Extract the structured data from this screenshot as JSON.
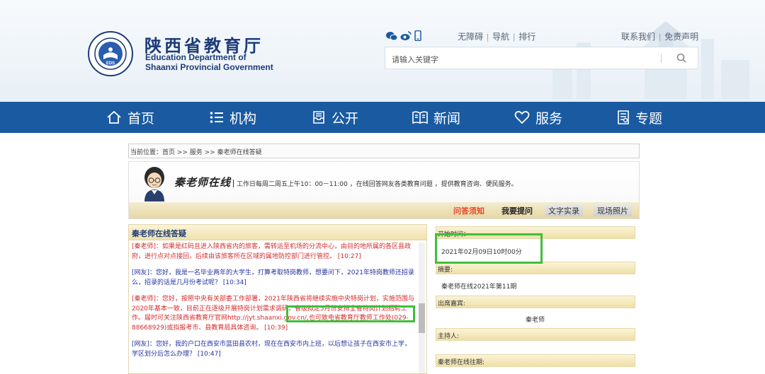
{
  "header": {
    "title_cn": "陕西省教育厅",
    "title_en_line1": "Education Department of",
    "title_en_line2": "Shaanxi Provincial Government",
    "social_icons": [
      "wechat-icon",
      "weibo-icon",
      "mobile-icon"
    ],
    "top_links": [
      "无障碍",
      "导航",
      "排行"
    ],
    "right_links": [
      "联系我们",
      "免责声明"
    ],
    "search": {
      "placeholder": "请输入关键字"
    }
  },
  "nav": {
    "items": [
      {
        "label": "首页",
        "icon": "home-icon"
      },
      {
        "label": "机构",
        "icon": "list-icon"
      },
      {
        "label": "公开",
        "icon": "inbox-icon"
      },
      {
        "label": "新闻",
        "icon": "book-icon"
      },
      {
        "label": "服务",
        "icon": "heart-icon"
      },
      {
        "label": "专题",
        "icon": "document-icon"
      }
    ],
    "color": "#1a5aa1"
  },
  "breadcrumb": "当前位置：首页 >> 服务 >> 秦老师在线答疑",
  "banner": {
    "title": "秦老师在线",
    "description": "工作日每周二周五上午10：00－11:00 ，在线回答网友各类教育问题 ，提供教育咨询、便民服务。",
    "tabs": [
      "问答须知",
      "我要提问",
      "文字实录",
      "现场照片"
    ]
  },
  "chat": {
    "title": "秦老师在线答疑",
    "messages": [
      {
        "role": "host",
        "text": "[秦老师]：如果是红码且进入陕西省内的旅客，需转运至机场的分流中心，由目的地所属的各区县政府，进行点对点接回，后续由该旅客所在区域的属地防控部门进行管控。  [10:27]"
      },
      {
        "role": "user",
        "text": "[网友]：您好，我是一名毕业两年的大学生，打算考取特岗教师，想要问下，2021年特岗教师还招录么，招录的话是几月份考试呢？  [10:34]"
      },
      {
        "role": "host",
        "text": "[秦老师]：您好，按照中央有关部委工作部署，2021年陕西省将继续实施中央特岗计划，实施范围与2020年基本一致，目前正在逐级开展特岗计划需求调研，省级拟定5月份安排全省特岗计划招聘工作。届时可关注陕西省教育厅官网http://jyt.shaanxi.gov.cn/,也可致电省教育厅教师工作处(029-88668929)或拟报考市、县教育局具体咨询。  [10:39]"
      },
      {
        "role": "user",
        "text": "[网友]：您好，我的户口在西安市蓝田县农村，现在在西安市内上班，以后想让孩子在西安市上学，学区划分后怎么办理？  [10:47]"
      }
    ]
  },
  "info": {
    "start_label": "开始时间：",
    "start_value": "2021年02月09日10时00分",
    "summary_label": "摘要:",
    "summary_value": "秦老师在线2021年第11期",
    "guest_label": "出席嘉宾:",
    "guest_value": "秦老师",
    "host_label": "主持人:",
    "past_label": "秦老师在线往期:"
  },
  "highlight_color": "#3fbf3a"
}
